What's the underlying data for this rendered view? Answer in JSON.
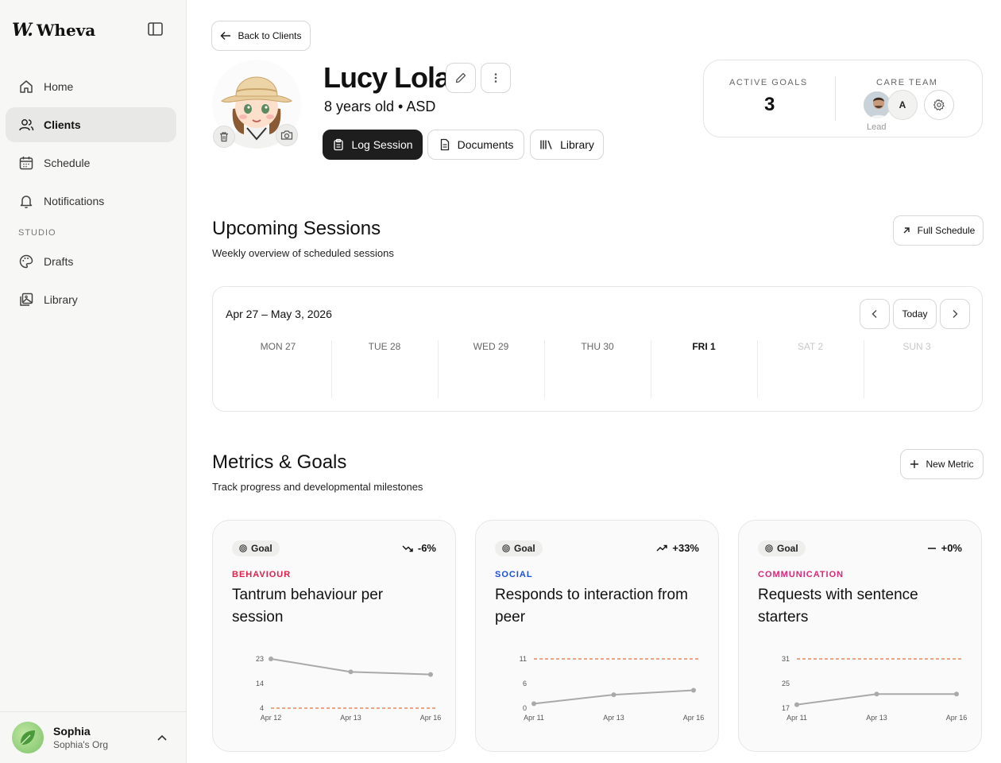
{
  "sidebar": {
    "brand": "Wheva",
    "items": [
      {
        "label": "Home"
      },
      {
        "label": "Clients"
      },
      {
        "label": "Schedule"
      },
      {
        "label": "Notifications"
      }
    ],
    "section_label": "STUDIO",
    "studio_items": [
      {
        "label": "Drafts"
      },
      {
        "label": "Library"
      }
    ],
    "user": {
      "name": "Sophia",
      "org": "Sophia's Org"
    }
  },
  "header": {
    "back_label": "Back to Clients",
    "client_name": "Lucy Lola",
    "client_sub": "8 years old • ASD",
    "log_session": "Log Session",
    "documents": "Documents",
    "library": "Library"
  },
  "stats": {
    "active_goals_label": "ACTIVE GOALS",
    "active_goals_value": "3",
    "care_team_label": "CARE TEAM",
    "member_initial": "A",
    "lead_label": "Lead"
  },
  "sessions": {
    "title": "Upcoming Sessions",
    "subtitle": "Weekly overview of scheduled sessions",
    "full_schedule": "Full Schedule",
    "range": "Apr 27 – May 3, 2026",
    "today": "Today",
    "days": [
      "MON 27",
      "TUE 28",
      "WED 29",
      "THU 30",
      "FRI 1",
      "SAT 2",
      "SUN 3"
    ]
  },
  "metrics": {
    "title": "Metrics & Goals",
    "subtitle": "Track progress and developmental milestones",
    "new_metric": "New Metric",
    "cards": [
      {
        "pill": "Goal",
        "trend": "-6%",
        "category": "BEHAVIOUR",
        "category_color": "#e11d48",
        "title": "Tantrum behaviour per session"
      },
      {
        "pill": "Goal",
        "trend": "+33%",
        "category": "SOCIAL",
        "category_color": "#1d4ed8",
        "title": "Responds to interaction from peer"
      },
      {
        "pill": "Goal",
        "trend": "+0%",
        "category": "COMMUNICATION",
        "category_color": "#db2777",
        "title": "Requests with sentence starters"
      }
    ]
  },
  "chart_data": [
    {
      "type": "line",
      "x": [
        "Apr 12",
        "Apr 13",
        "Apr 16"
      ],
      "y": [
        23,
        18,
        17
      ],
      "y_ticks": [
        "23",
        "14",
        "4"
      ],
      "target": 4,
      "ylim": [
        4,
        23
      ]
    },
    {
      "type": "line",
      "x": [
        "Apr 11",
        "Apr 13",
        "Apr 16"
      ],
      "y": [
        1,
        3,
        4
      ],
      "y_ticks": [
        "11",
        "6",
        "0"
      ],
      "target": 11,
      "ylim": [
        0,
        11
      ]
    },
    {
      "type": "line",
      "x": [
        "Apr 11",
        "Apr 13",
        "Apr 16"
      ],
      "y": [
        18,
        21,
        21
      ],
      "y_ticks": [
        "31",
        "25",
        "17"
      ],
      "target": 31,
      "ylim": [
        17,
        31
      ]
    }
  ]
}
